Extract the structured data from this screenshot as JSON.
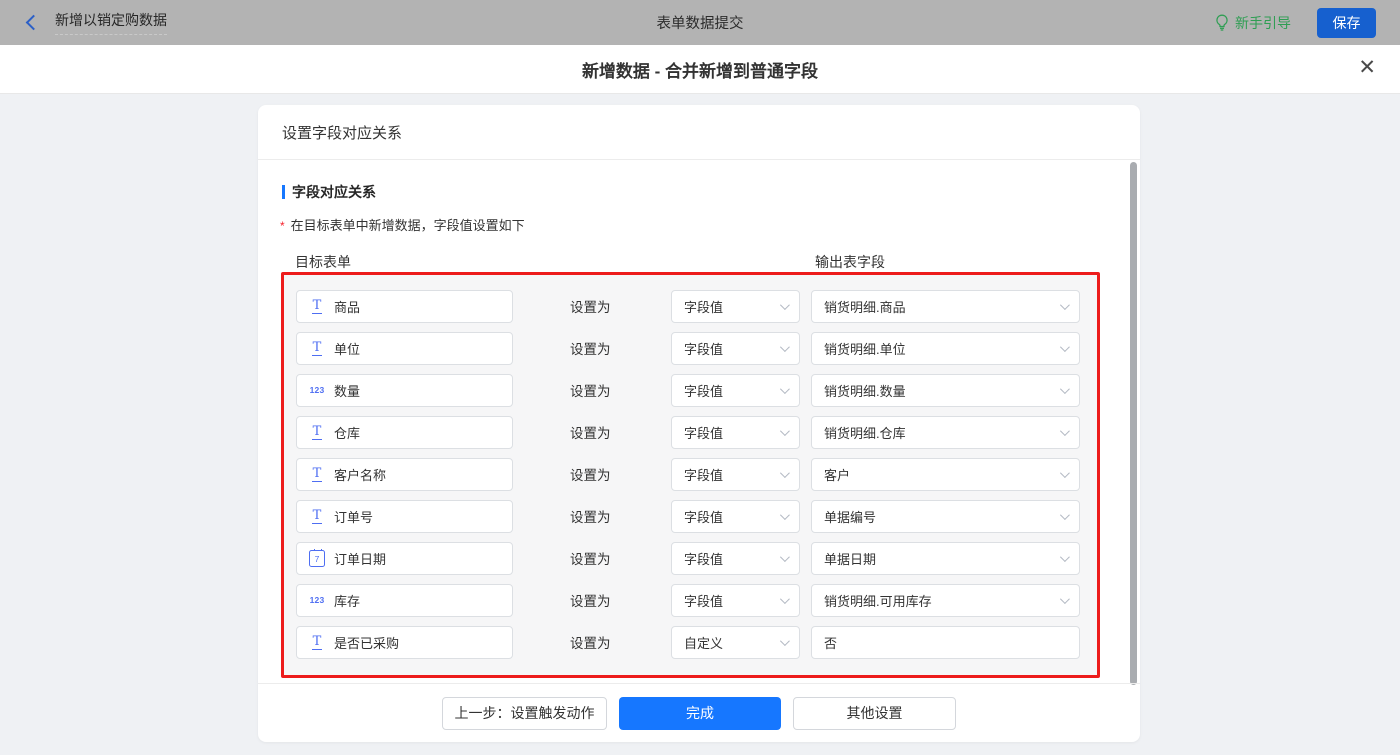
{
  "topbar": {
    "back_title": "新增以销定购数据",
    "center_title": "表单数据提交",
    "guide_label": "新手引导",
    "save_label": "保存"
  },
  "dialog": {
    "title": "新增数据 - 合并新增到普通字段",
    "close_glyph": "✕"
  },
  "card": {
    "header": "设置字段对应关系",
    "section_title": "字段对应关系",
    "required_mark": "*",
    "note": "在目标表单中新增数据，字段值设置如下",
    "col_left": "目标表单",
    "col_right": "输出表字段",
    "set_as_label": "设置为"
  },
  "rows": [
    {
      "icon": "text-field-icon",
      "field": "商品",
      "mode": "字段值",
      "value": "销货明细.商品",
      "value_has_dropdown": true
    },
    {
      "icon": "text-field-icon",
      "field": "单位",
      "mode": "字段值",
      "value": "销货明细.单位",
      "value_has_dropdown": true
    },
    {
      "icon": "number-field-icon",
      "field": "数量",
      "mode": "字段值",
      "value": "销货明细.数量",
      "value_has_dropdown": true
    },
    {
      "icon": "text-field-icon",
      "field": "仓库",
      "mode": "字段值",
      "value": "销货明细.仓库",
      "value_has_dropdown": true
    },
    {
      "icon": "text-field-icon",
      "field": "客户名称",
      "mode": "字段值",
      "value": "客户",
      "value_has_dropdown": true
    },
    {
      "icon": "text-field-icon",
      "field": "订单号",
      "mode": "字段值",
      "value": "单据编号",
      "value_has_dropdown": true
    },
    {
      "icon": "date-field-icon",
      "field": "订单日期",
      "mode": "字段值",
      "value": "单据日期",
      "value_has_dropdown": true
    },
    {
      "icon": "number-field-icon",
      "field": "库存",
      "mode": "字段值",
      "value": "销货明细.可用库存",
      "value_has_dropdown": true
    },
    {
      "icon": "text-field-icon",
      "field": "是否已采购",
      "mode": "自定义",
      "value": "否",
      "value_has_dropdown": false
    }
  ],
  "footer": {
    "prev_label": "上一步：设置触发动作",
    "done_label": "完成",
    "other_label": "其他设置"
  },
  "colors": {
    "accent_blue": "#1677ff",
    "save_blue": "#1660cf",
    "guide_green": "#2f9e53",
    "highlight_red": "#ed1c1c",
    "required_red": "#f5222d",
    "field_icon_blue": "#4e6ef2",
    "topbar_gray": "#b3b3b3"
  }
}
